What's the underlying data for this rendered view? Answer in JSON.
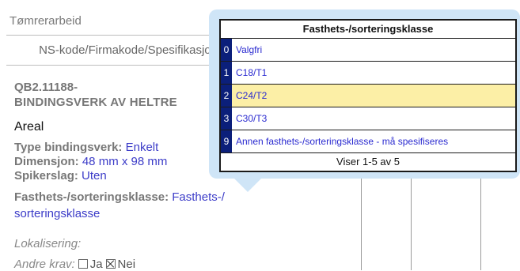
{
  "section": {
    "title": "Tømrerarbeid",
    "code_header": "NS-kode/Firmakode/Spesifikasjon"
  },
  "item": {
    "code": "QB2.11188-",
    "name": "BINDINGSVERK AV HELTRE",
    "unit": "Areal",
    "props": {
      "type_label": "Type bindingsverk: ",
      "type_value": "Enkelt",
      "dim_label": "Dimensjon: ",
      "dim_value": "48 mm x 98 mm",
      "spiker_label": "Spikerslag: ",
      "spiker_value": "Uten",
      "class_label": "Fasthets-/sorteringsklasse: ",
      "class_value_1": "Fasthets-/",
      "class_value_2": "sorteringsklasse"
    },
    "localization_label": "Lokalisering:",
    "other_req_label": "Andre krav:",
    "other_req_yes": "Ja",
    "other_req_no": "Nei"
  },
  "lookup": {
    "title": "Fasthets-/sorteringsklasse",
    "options": [
      {
        "key": "0",
        "label": "Valgfri"
      },
      {
        "key": "1",
        "label": "C18/T1"
      },
      {
        "key": "2",
        "label": "C24/T2"
      },
      {
        "key": "3",
        "label": "C30/T3"
      },
      {
        "key": "9",
        "label": "Annen fasthets-/sorteringsklasse - må spesifiseres"
      }
    ],
    "selected_key": "2",
    "footer": "Viser 1-5 av 5"
  },
  "colors": {
    "popup_bg": "#cfe5f7",
    "key_bg": "#0b1f7a",
    "selected_bg": "#fcefa6",
    "link": "#3c3cc8"
  }
}
